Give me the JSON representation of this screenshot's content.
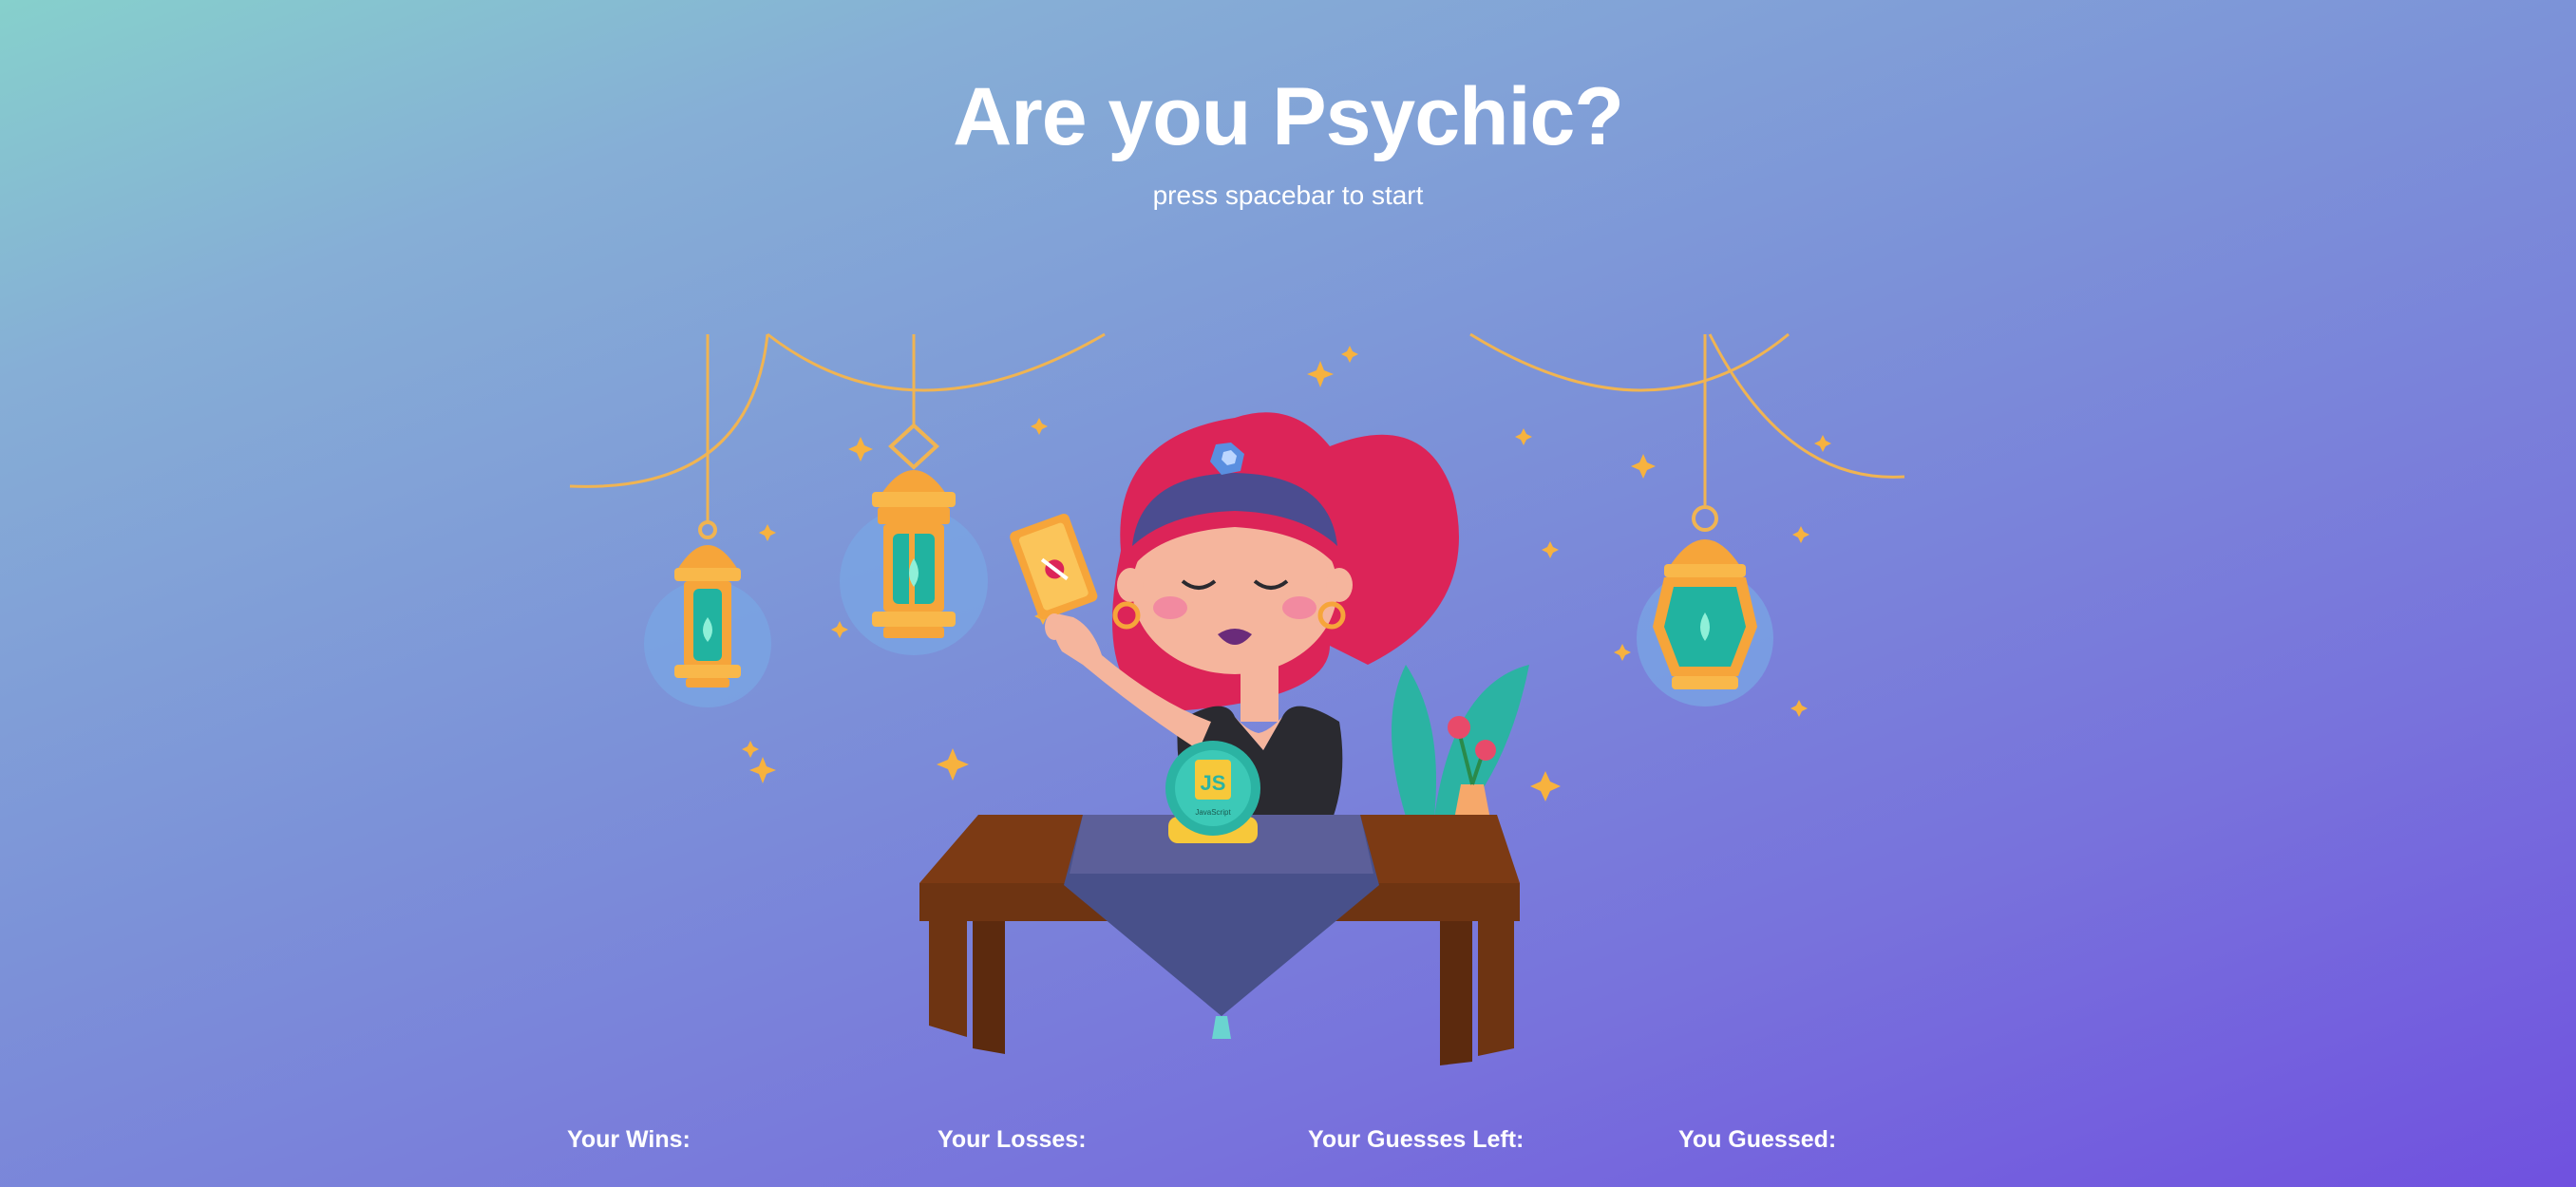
{
  "header": {
    "title": "Are you Psychic?",
    "instruction": "press spacebar to start"
  },
  "illustration": {
    "crystal_ball_label": "JS",
    "crystal_ball_sublabel": "JavaScript"
  },
  "stats": {
    "wins_label": "Your Wins:",
    "wins_value": "",
    "losses_label": "Your Losses:",
    "losses_value": "",
    "guesses_left_label": "Your Guesses Left:",
    "guesses_left_value": "",
    "guessed_label": "You Guessed:",
    "guessed_value": ""
  },
  "colors": {
    "background_start": "#86d0cc",
    "background_end": "#7051df",
    "text": "#ffffff",
    "hair": "#dc2458",
    "lantern_gold": "#f6a53a",
    "lantern_glass": "#21b3a0",
    "table_wood": "#6e3412",
    "table_cloth": "#48508a"
  },
  "icons": [
    "lantern-icon",
    "sparkle-icon",
    "tarot-card-icon",
    "crystal-ball-icon",
    "rose-vase-icon"
  ]
}
